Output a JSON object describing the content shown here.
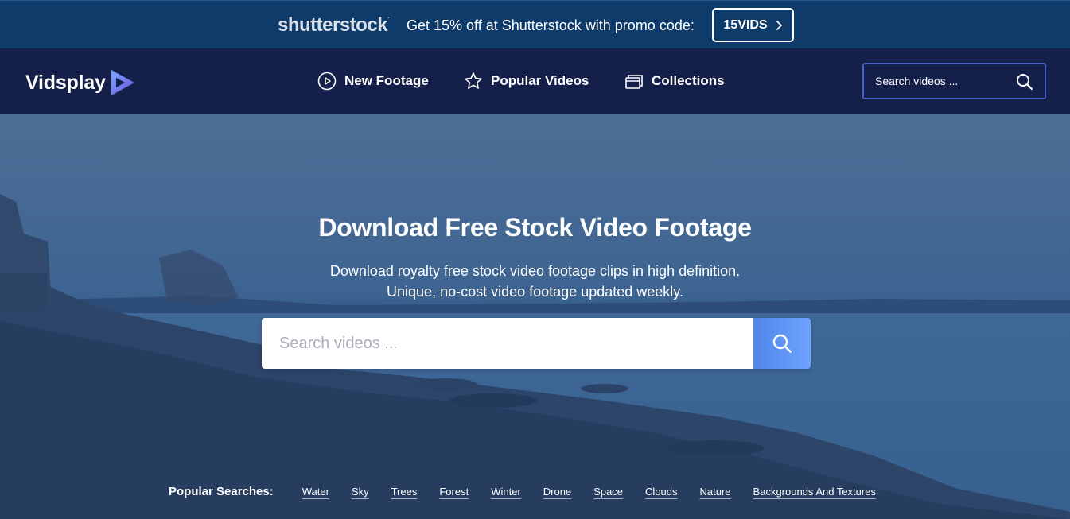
{
  "promo": {
    "logo": "shutterstock",
    "text": "Get 15% off at Shutterstock with promo code:",
    "code": "15VIDS"
  },
  "nav": {
    "brand": "Vidsplay",
    "links": [
      {
        "label": "New Footage",
        "icon": "play-circle-icon"
      },
      {
        "label": "Popular Videos",
        "icon": "star-icon"
      },
      {
        "label": "Collections",
        "icon": "collections-icon"
      }
    ],
    "search_placeholder": "Search videos ..."
  },
  "hero": {
    "title": "Download Free Stock Video Footage",
    "subtitle_line1": "Download royalty free stock video footage clips in high definition.",
    "subtitle_line2": "Unique, no-cost video footage updated weekly.",
    "search_placeholder": "Search videos ...",
    "popular_label": "Popular Searches:",
    "popular_tags": [
      "Water",
      "Sky",
      "Trees",
      "Forest",
      "Winter",
      "Drone",
      "Space",
      "Clouds",
      "Nature",
      "Backgrounds And Textures"
    ]
  },
  "colors": {
    "promo_bg": "#0f3b6a",
    "nav_bg": "#15204a",
    "accent": "#4b5fc8",
    "search_button": "#5b8ff0"
  }
}
